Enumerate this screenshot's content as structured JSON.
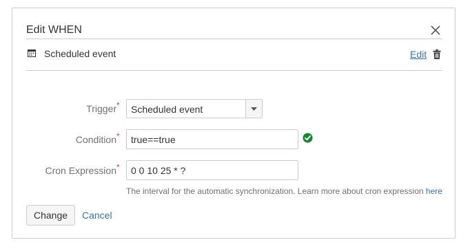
{
  "dialog": {
    "title": "Edit WHEN",
    "close_icon": "close-icon"
  },
  "event": {
    "icon": "calendar-icon",
    "label": "Scheduled event",
    "edit_label": "Edit",
    "delete_icon": "trash-icon"
  },
  "form": {
    "trigger": {
      "label": "Trigger",
      "required": "*",
      "value": "Scheduled event"
    },
    "condition": {
      "label": "Condition",
      "required": "*",
      "value": "true==true",
      "status_icon": "valid-check-icon"
    },
    "cron": {
      "label": "Cron Expression",
      "required": "*",
      "value": "0 0 10 25 * ?"
    },
    "hint": {
      "text": "The interval for the automatic synchronization. Learn more about cron expression",
      "link": "here"
    }
  },
  "actions": {
    "change_label": "Change",
    "cancel_label": "Cancel"
  },
  "colors": {
    "link": "#3572b0",
    "required": "#d04437",
    "valid": "#14892c",
    "border": "#cccccc"
  }
}
